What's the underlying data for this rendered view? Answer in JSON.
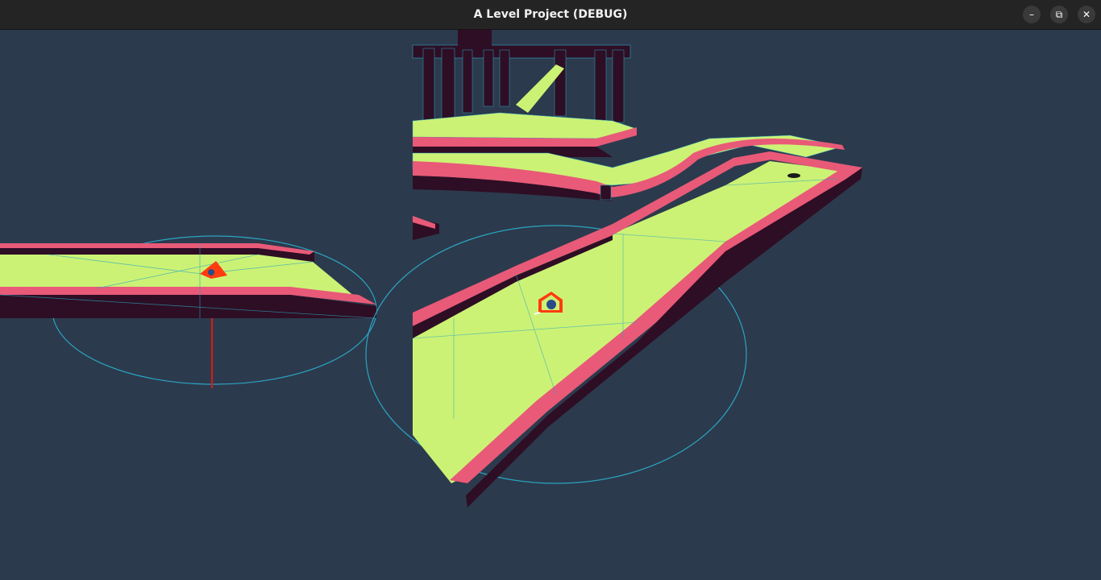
{
  "window": {
    "title": "A Level Project (DEBUG)",
    "controls": {
      "minimize": "–",
      "maximize": "⧉",
      "close": "✕"
    }
  },
  "scene": {
    "background_color": "#2c3a4d",
    "green_color": "#ccf275",
    "wall_color": "#e85a78",
    "wall_dark_color": "#2e0e24",
    "wire_color": "#2aa5c2"
  }
}
